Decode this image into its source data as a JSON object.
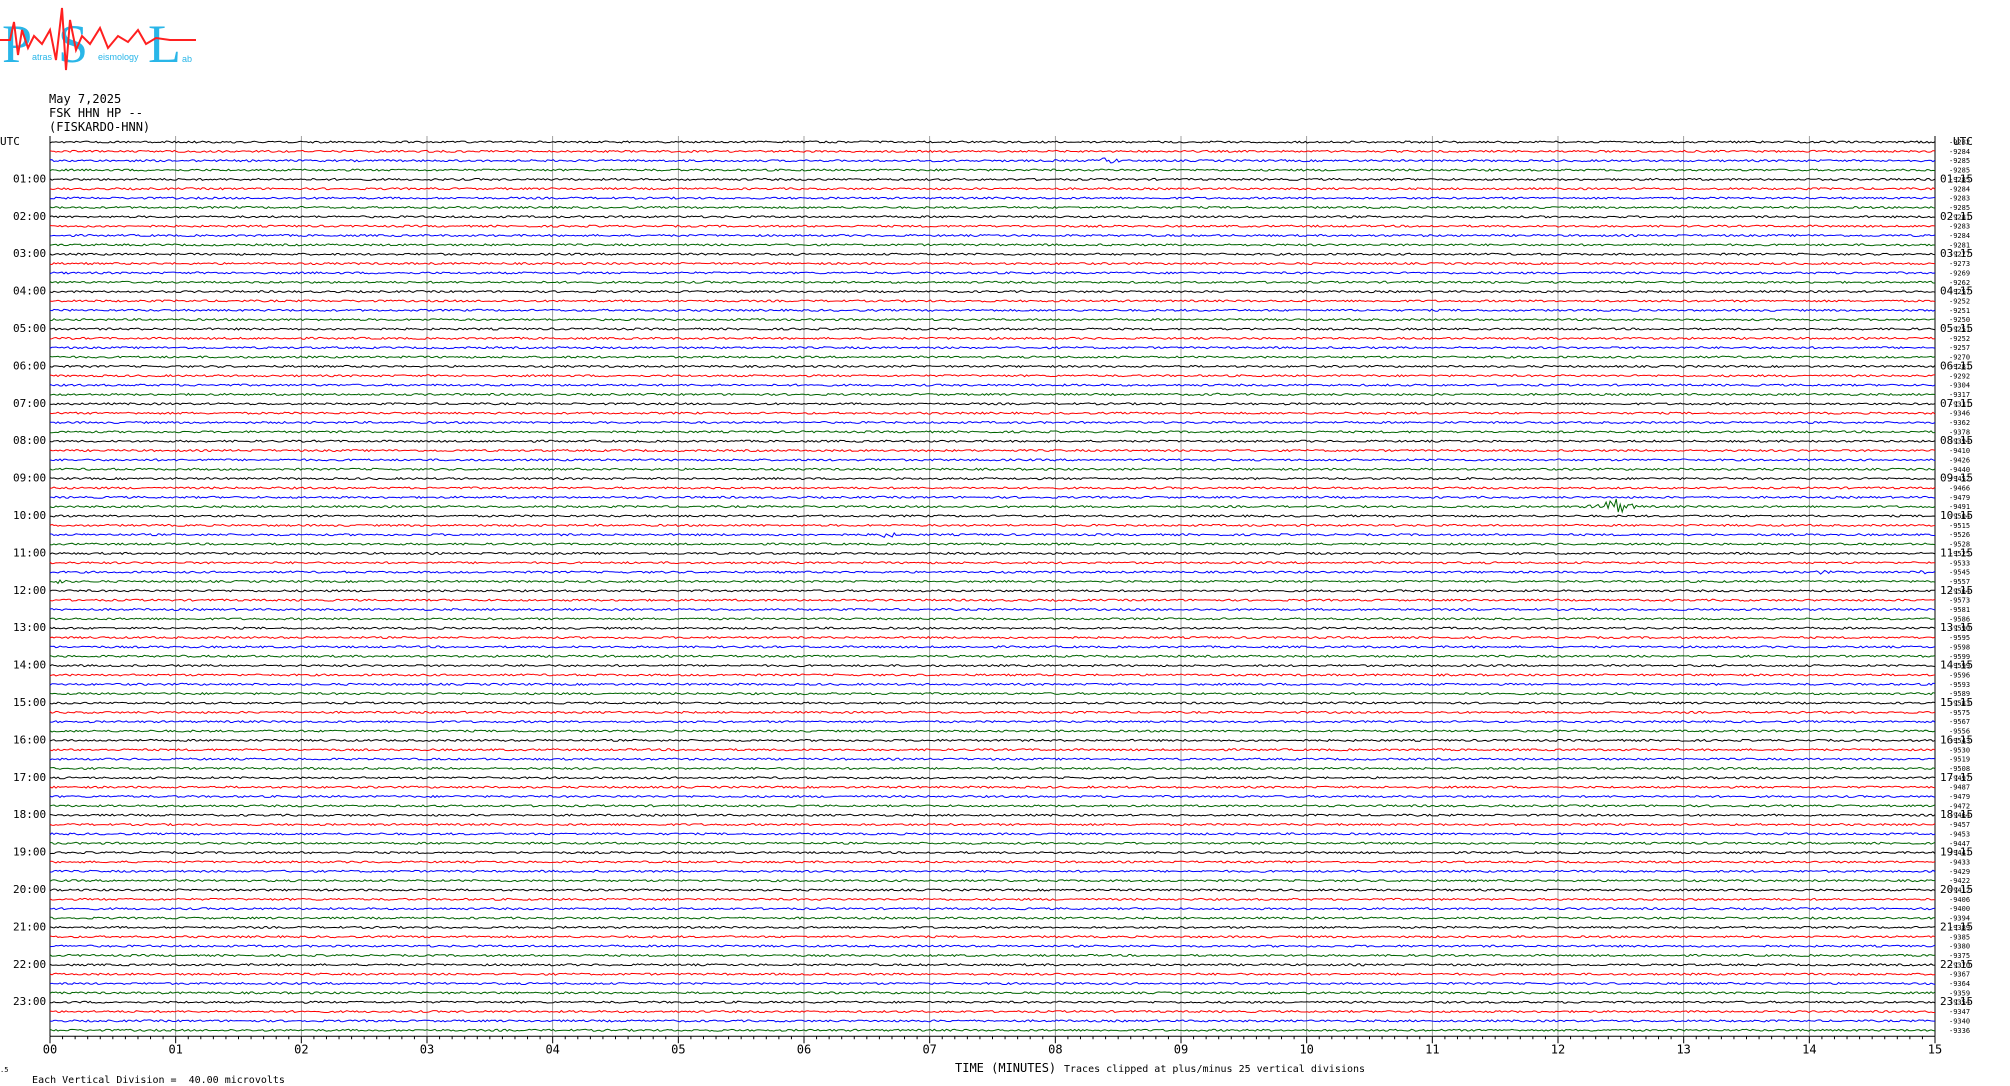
{
  "logo": {
    "letters": [
      "P",
      "S",
      "L"
    ],
    "subtext": [
      "atras",
      "eismology",
      "ab"
    ],
    "colors": {
      "letters": "#29b6e8",
      "wave": "#ff2020"
    }
  },
  "header": {
    "date": "May 7,2025",
    "station": "FSK HHN HP --",
    "site": "(FISKARDO-HNN)"
  },
  "colors": {
    "trace_cycle": [
      "#000000",
      "#ff0000",
      "#0000ff",
      "#006400"
    ],
    "grid": "#888888"
  },
  "chart_data": {
    "type": "line",
    "xlabel": "TIME (MINUTES)",
    "x_ticks": [
      "00",
      "01",
      "02",
      "03",
      "04",
      "05",
      "06",
      "07",
      "08",
      "09",
      "10",
      "11",
      "12",
      "13",
      "14",
      "15"
    ],
    "xlim": [
      0,
      15
    ],
    "utc_label": "UTC",
    "left_hour_labels": [
      "01:00",
      "02:00",
      "03:00",
      "04:00",
      "05:00",
      "06:00",
      "07:00",
      "08:00",
      "09:00",
      "10:00",
      "11:00",
      "12:00",
      "13:00",
      "14:00",
      "15:00",
      "16:00",
      "17:00",
      "18:00",
      "19:00",
      "20:00",
      "21:00",
      "22:00",
      "23:00"
    ],
    "right_hour_labels": [
      "01:15",
      "02:15",
      "03:15",
      "04:15",
      "05:15",
      "06:15",
      "07:15",
      "08:15",
      "09:15",
      "10:15",
      "11:15",
      "12:15",
      "13:15",
      "14:15",
      "15:15",
      "16:15",
      "17:15",
      "18:15",
      "19:15",
      "20:15",
      "21:15",
      "22:15",
      "23:15"
    ],
    "trace_count": 96,
    "trace_offsets": [
      -9282,
      -9284,
      -9285,
      -9285,
      -9285,
      -9284,
      -9283,
      -9285,
      -9281,
      -9283,
      -9284,
      -9281,
      -9277,
      -9273,
      -9269,
      -9262,
      -9257,
      -9252,
      -9251,
      -9250,
      -9251,
      -9252,
      -9257,
      -9270,
      -9281,
      -9292,
      -9304,
      -9317,
      -9331,
      -9346,
      -9362,
      -9378,
      -9394,
      -9410,
      -9426,
      -9440,
      -9452,
      -9466,
      -9479,
      -9491,
      -9504,
      -9515,
      -9526,
      -9528,
      -9525,
      -9533,
      -9545,
      -9557,
      -9564,
      -9573,
      -9581,
      -9586,
      -9590,
      -9595,
      -9598,
      -9599,
      -9599,
      -9596,
      -9593,
      -9589,
      -9583,
      -9575,
      -9567,
      -9556,
      -9543,
      -9530,
      -9519,
      -9508,
      -9497,
      -9487,
      -9479,
      -9472,
      -9464,
      -9457,
      -9453,
      -9447,
      -9441,
      -9433,
      -9429,
      -9422,
      -9412,
      -9406,
      -9400,
      -9394,
      -9389,
      -9385,
      -9380,
      -9375,
      -9370,
      -9367,
      -9364,
      -9359,
      -9354,
      -9347,
      -9340,
      -9336
    ],
    "events": [
      {
        "trace": 2,
        "minute": 8.42,
        "amplitude": 3.5
      },
      {
        "trace": 5,
        "minute": 3.05,
        "amplitude": 1.2
      },
      {
        "trace": 27,
        "minute": 9.3,
        "amplitude": 1.6
      },
      {
        "trace": 29,
        "minute": 0.7,
        "amplitude": 1.3
      },
      {
        "trace": 35,
        "minute": 5.8,
        "amplitude": 1.4
      },
      {
        "trace": 39,
        "minute": 12.45,
        "amplitude": 9.0
      },
      {
        "trace": 42,
        "minute": 6.65,
        "amplitude": 3.2
      },
      {
        "trace": 43,
        "minute": 5.9,
        "amplitude": 1.4
      },
      {
        "trace": 44,
        "minute": 1.9,
        "amplitude": 1.3
      },
      {
        "trace": 47,
        "minute": 0.05,
        "amplitude": 2.5
      },
      {
        "trace": 46,
        "minute": 14.1,
        "amplitude": 2.2
      },
      {
        "trace": 46,
        "minute": 14.9,
        "amplitude": 2.0
      }
    ]
  },
  "footer": {
    "scale_prefix": "Each Vertical Division =",
    "scale_value": "40.00 microvolts",
    "clip_note": "Traces clipped at plus/minus 25 vertical divisions",
    "corner_mark": ".5"
  }
}
